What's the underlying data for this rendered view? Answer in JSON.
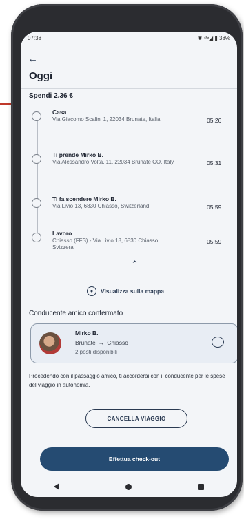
{
  "status": {
    "time": "07:38",
    "indicators": "✱ ⁴ᴳ◢ ▮ 38%"
  },
  "header": {
    "back_icon": "arrow-left-icon",
    "title": "Oggi"
  },
  "trip": {
    "cost_label": "Spendi 2.36 €",
    "stops": [
      {
        "name": "Casa",
        "address": "Via Giacomo Scalini 1, 22034 Brunate, Italia",
        "time": "05:26"
      },
      {
        "name": "Ti prende Mirko B.",
        "address": "Via Alessandro Volta, 11, 22034 Brunate CO, Italy",
        "time": "05:31"
      },
      {
        "name": "Ti fa scendere Mirko B.",
        "address": "Via Livio 13, 6830 Chiasso, Switzerland",
        "time": "05:59"
      },
      {
        "name": "Lavoro",
        "address": "Chiasso (FFS) - Via Livio 18, 6830 Chiasso, Svizzera",
        "time": "05:59"
      }
    ],
    "collapse_icon": "chevron-up-icon",
    "map_link": "Visualizza sulla mappa"
  },
  "driver": {
    "section_title": "Conducente amico confermato",
    "name": "Mirko B.",
    "from": "Brunate",
    "arrow": "→",
    "to": "Chiasso",
    "seats": "2 posti disponibili"
  },
  "notice": "Procedendo con il passaggio amico, ti accorderai con il conducente per le spese del viaggio in autonomia.",
  "actions": {
    "cancel": "CANCELLA VIAGGIO",
    "checkout": "Effettua check-out"
  },
  "colors": {
    "primary": "#254b72",
    "background": "#f3f5f8",
    "card": "#e8edf4"
  }
}
